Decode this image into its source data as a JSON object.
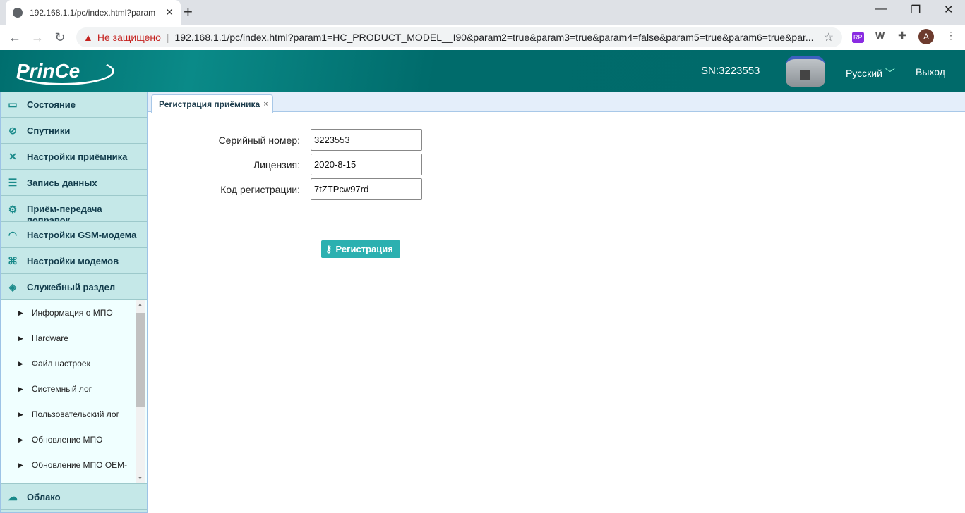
{
  "browser": {
    "tab_title": "192.168.1.1/pc/index.html?param",
    "security": "Не защищено",
    "url": "192.168.1.1/pc/index.html?param1=HC_PRODUCT_MODEL__I90&param2=true&param3=true&param4=false&param5=true&param6=true&par...",
    "profile_initial": "A",
    "ext_rp": "RP",
    "ext_w": "W"
  },
  "header": {
    "logo": "PrinCe",
    "sn": "SN:3223553",
    "language": "Русский",
    "logout": "Выход"
  },
  "sidebar": {
    "items": [
      {
        "label": "Состояние",
        "icon": "monitor-icon"
      },
      {
        "label": "Спутники",
        "icon": "satellite-icon"
      },
      {
        "label": "Настройки приёмника",
        "icon": "tools-icon"
      },
      {
        "label": "Запись данных",
        "icon": "list-icon"
      },
      {
        "label": "Приём-передача поправок",
        "icon": "gear-icon"
      },
      {
        "label": "Настройки GSM-модема",
        "icon": "wifi-icon"
      },
      {
        "label": "Настройки модемов",
        "icon": "modules-icon"
      },
      {
        "label": "Служебный раздел",
        "icon": "layers-icon"
      }
    ],
    "sub_items": [
      "Информация о МПО",
      "Hardware",
      "Файл настроек",
      "Системный лог",
      "Пользовательский лог",
      "Обновление МПО",
      "Обновление МПО OEM-"
    ],
    "cloud": "Облако"
  },
  "main": {
    "tab": "Регистрация приёмника",
    "fields": [
      {
        "label": "Серийный номер:",
        "value": "3223553"
      },
      {
        "label": "Лицензия:",
        "value": "2020-8-15"
      },
      {
        "label": "Код регистрации:",
        "value": "7tZTPcw97rd"
      }
    ],
    "register_button": "Регистрация"
  }
}
